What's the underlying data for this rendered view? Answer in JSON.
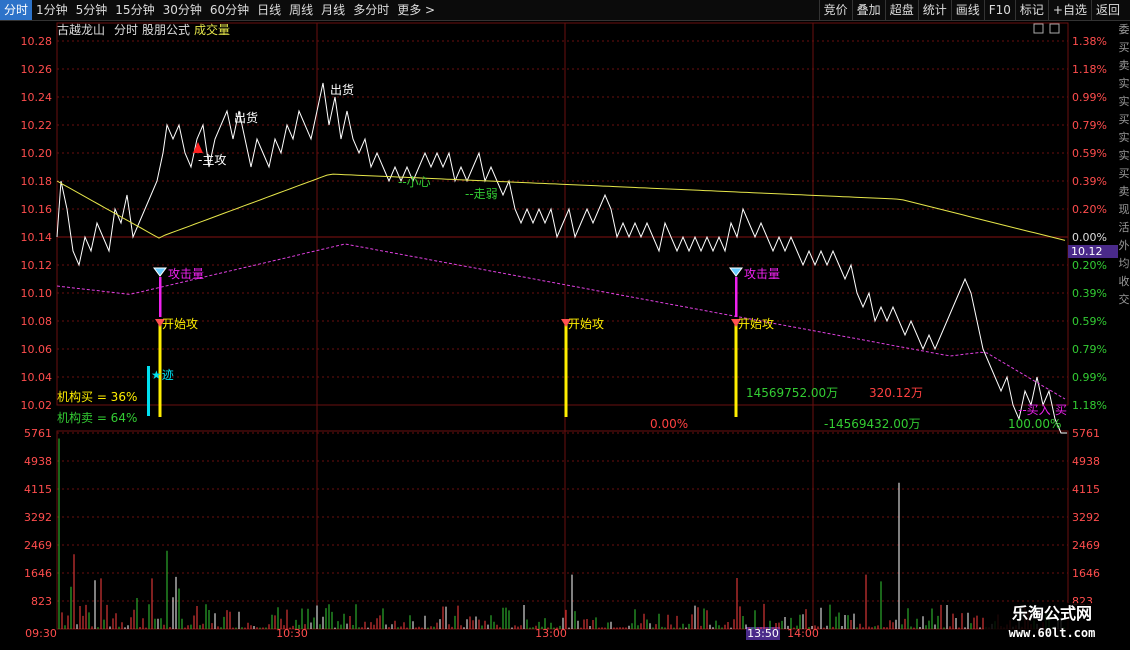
{
  "toolbar": {
    "left": [
      "分时",
      "1分钟",
      "5分钟",
      "15分钟",
      "30分钟",
      "60分钟",
      "日线",
      "周线",
      "月线",
      "多分时",
      "更多 >"
    ],
    "active": 0,
    "right": [
      "竞价",
      "叠加",
      "超盘",
      "统计",
      "画线",
      "F10",
      "标记",
      "+自选",
      "返回"
    ]
  },
  "header": {
    "stock_name": "古越龙山",
    "mode": "分时",
    "formula": "股朋公式",
    "indicator": "成交量"
  },
  "price_axis": {
    "left_ticks": [
      "10.28",
      "10.26",
      "10.24",
      "10.22",
      "10.20",
      "10.18",
      "10.16",
      "10.14",
      "10.12",
      "10.10",
      "10.08",
      "10.06",
      "10.04",
      "10.02"
    ],
    "right_ticks": [
      "1.38%",
      "1.18%",
      "0.99%",
      "0.79%",
      "0.59%",
      "0.39%",
      "0.20%",
      "0.00%",
      "0.20%",
      "0.39%",
      "0.59%",
      "0.79%",
      "0.99%",
      "1.18%"
    ],
    "current_price": "10.12"
  },
  "volume_axis": {
    "ticks": [
      "5761",
      "4938",
      "4115",
      "3292",
      "2469",
      "1646",
      "823"
    ]
  },
  "time_axis": {
    "labels": [
      "09:30",
      "10:30",
      "13:00",
      "14:00"
    ],
    "cursor_label": "13:50"
  },
  "annotations": {
    "main_attack": "-主攻",
    "sell1": "出货",
    "sell2": "出货",
    "caution": "--小心",
    "weak": "--走弱",
    "buy_in": "--买入",
    "buy_in_tail": "买",
    "attack_vol": "攻击量",
    "start_attack": "开始攻",
    "trace": "★迹",
    "inst_buy": "机构买 = 36%",
    "inst_sell": "机构卖 = 64%",
    "val_pct1": "0.00%",
    "val_amount_pos": "14569752.00万",
    "val_amount_neg": "-14569432.00万",
    "val_small": "320.12万",
    "val_pct2": "100.00%"
  },
  "right_strip_text": [
    "委",
    "买",
    "卖",
    "实",
    "实",
    "买",
    "实",
    "实",
    "买",
    "卖",
    "现",
    "活",
    "外",
    "均",
    "收",
    "交"
  ],
  "watermark": {
    "title": "乐淘公式网",
    "url": "www.60lt.com"
  },
  "colors": {
    "price_line": "#ffffff",
    "avg_line": "#e6e64a",
    "ma_line": "#e040e0",
    "grid": "#6a0f0f",
    "axis_text": "#ff4d4d",
    "vol_up": "#ff4040",
    "vol_down": "#33cc33",
    "vol_flat": "#ffffff"
  }
}
